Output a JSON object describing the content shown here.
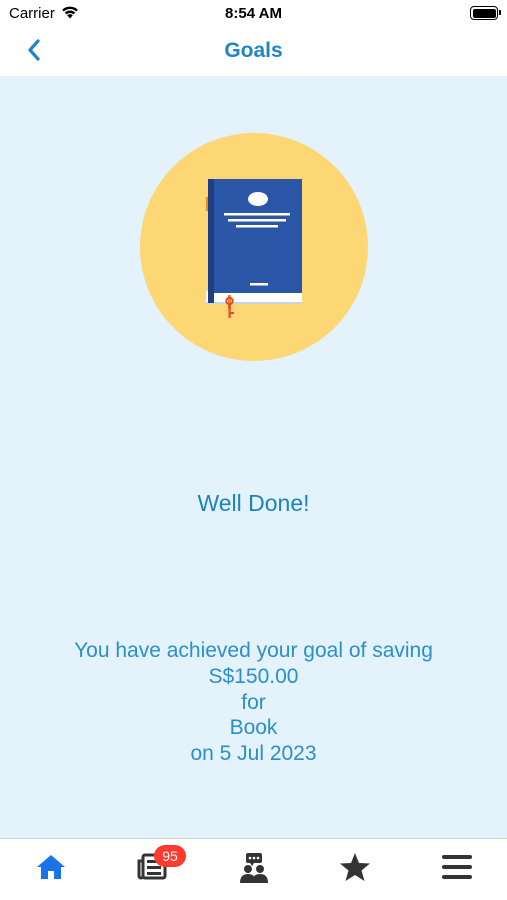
{
  "status_bar": {
    "carrier": "Carrier",
    "time": "8:54 AM"
  },
  "nav": {
    "title": "Goals",
    "back_icon": "chevron-left-icon"
  },
  "goal": {
    "icon": "book-icon",
    "heading": "Well Done!",
    "message_line1": "You have achieved your goal of saving",
    "amount": "S$150.00",
    "for_label": "for",
    "goal_name": "Book",
    "date_line": "on 5 Jul 2023"
  },
  "tab_bar": {
    "tabs": [
      {
        "name": "home",
        "icon": "home-icon",
        "active": true
      },
      {
        "name": "news",
        "icon": "newspaper-icon",
        "badge": "95"
      },
      {
        "name": "community",
        "icon": "community-chat-icon"
      },
      {
        "name": "favorites",
        "icon": "star-icon"
      },
      {
        "name": "menu",
        "icon": "menu-icon"
      }
    ]
  },
  "colors": {
    "accent": "#1e86c8",
    "background": "#e3f2fb",
    "circle": "#fdd773",
    "tab_active": "#1a73e8",
    "tab_inactive": "#333333",
    "badge": "#ff3b30"
  }
}
